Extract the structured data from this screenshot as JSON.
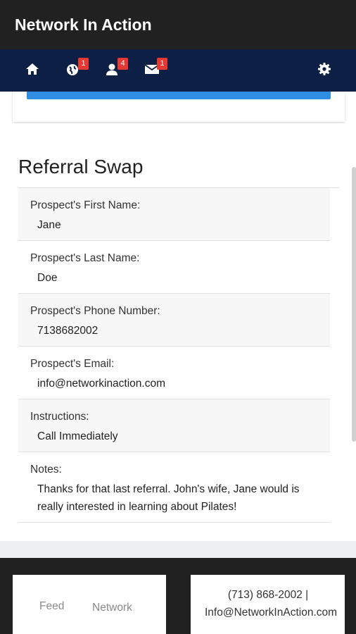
{
  "app": {
    "title": "Network In Action"
  },
  "nav": {
    "badges": {
      "globe": "1",
      "user": "4",
      "mail": "1"
    }
  },
  "referral": {
    "title": "Referral Swap",
    "fields": [
      {
        "label": "Prospect's First Name:",
        "value": "Jane"
      },
      {
        "label": "Prospect's Last Name:",
        "value": "Doe"
      },
      {
        "label": "Prospect's Phone Number:",
        "value": "7138682002"
      },
      {
        "label": "Prospect's Email:",
        "value": "info@networkinaction.com"
      },
      {
        "label": "Instructions:",
        "value": "Call Immediately"
      },
      {
        "label": "Notes:",
        "value": "Thanks for that last referral. John's wife, Jane would is really interested in learning about Pilates!"
      }
    ]
  },
  "footer": {
    "links": {
      "feed": "Feed",
      "network": "Network"
    },
    "contact": {
      "phone": "(713) 868-2002 |",
      "email": "Info@NetworkInAction.com"
    }
  },
  "colors": {
    "app_bar": "#212121",
    "nav_bar": "#0d1f45",
    "accent": "#2f8de4",
    "badge": "#e53935"
  }
}
